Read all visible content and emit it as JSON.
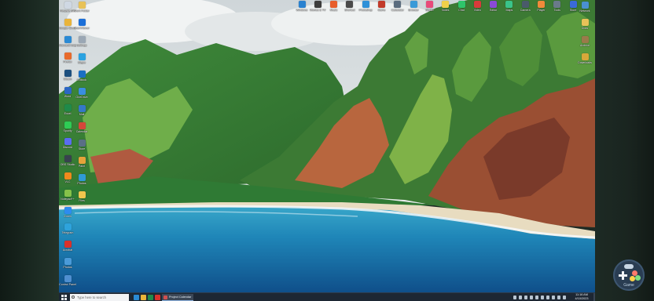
{
  "desktop": {
    "left_icons": [
      {
        "label": "Recycle Bin",
        "color": "#cfd8e3"
      },
      {
        "label": "Google Chrome",
        "color": "#e9b43a"
      },
      {
        "label": "Microsoft Edge",
        "color": "#2a8ad4"
      },
      {
        "label": "Firefox",
        "color": "#e86a2b"
      },
      {
        "label": "Steam",
        "color": "#1c4f7e"
      },
      {
        "label": "Word",
        "color": "#2b67c4"
      },
      {
        "label": "Excel",
        "color": "#1f8a4a"
      },
      {
        "label": "Spotify",
        "color": "#2ecc55"
      },
      {
        "label": "Discord",
        "color": "#5a6cf0"
      },
      {
        "label": "OBS Studio",
        "color": "#38424e"
      },
      {
        "label": "VLC",
        "color": "#f08a1c"
      },
      {
        "label": "Notepad++",
        "color": "#86c24a"
      },
      {
        "label": "Zoom",
        "color": "#2d8cf0"
      },
      {
        "label": "Telegram",
        "color": "#2ea3dc"
      },
      {
        "label": "Acrobat",
        "color": "#d9312b"
      },
      {
        "label": "Photos",
        "color": "#4a9ad8"
      },
      {
        "label": "Control Panel",
        "color": "#4f8fd0"
      }
    ],
    "second_column_icons": [
      {
        "label": "Work Folder",
        "color": "#e8c258"
      },
      {
        "label": "TeamViewer",
        "color": "#1b6fd8"
      },
      {
        "label": "Settings",
        "color": "#9aa7b4"
      },
      {
        "label": "Skype",
        "color": "#2ba2e0"
      },
      {
        "label": "Outlook",
        "color": "#1a6fc4"
      },
      {
        "label": "OneDrive",
        "color": "#3a8ee0"
      },
      {
        "label": "Mail",
        "color": "#3478c8"
      },
      {
        "label": "Calendar",
        "color": "#d6473a"
      },
      {
        "label": "Store",
        "color": "#5a6f86"
      },
      {
        "label": "Paint",
        "color": "#e5a33a"
      },
      {
        "label": "Photos",
        "color": "#2f9ad6"
      },
      {
        "label": "Files",
        "color": "#f0c64d"
      }
    ],
    "top_icons": [
      {
        "label": "Windows",
        "color": "#2a82d0"
      },
      {
        "label": "Movies & TV",
        "color": "#3d3d3d"
      },
      {
        "label": "Music",
        "color": "#e85d2a"
      },
      {
        "label": "Shortcut",
        "color": "#4a4a4a"
      },
      {
        "label": "Photoshop",
        "color": "#2e90d8"
      },
      {
        "label": "Game",
        "color": "#c23a2a"
      },
      {
        "label": "Calculator",
        "color": "#5a6c7e"
      },
      {
        "label": "Browser",
        "color": "#3a9ad8"
      },
      {
        "label": "Studio",
        "color": "#e84a7a"
      },
      {
        "label": "Notes",
        "color": "#f0d04a"
      },
      {
        "label": "Chat",
        "color": "#2ec46a"
      },
      {
        "label": "Video",
        "color": "#d83a3a"
      },
      {
        "label": "Editor",
        "color": "#8a4ad8"
      },
      {
        "label": "Maps",
        "color": "#3ac48a"
      },
      {
        "label": "Camera",
        "color": "#4a5a6a"
      },
      {
        "label": "Player",
        "color": "#f08a3a"
      },
      {
        "label": "Tools",
        "color": "#6a7a8a"
      },
      {
        "label": "Store",
        "color": "#3a6ad8"
      }
    ],
    "right_icons": [
      {
        "label": "Network",
        "color": "#4a90d0"
      },
      {
        "label": "Docs",
        "color": "#e8c258"
      },
      {
        "label": "Archive",
        "color": "#9a7a4a"
      },
      {
        "label": "Downloads",
        "color": "#d8a83a"
      }
    ]
  },
  "taskbar": {
    "search_placeholder": "Type here to search",
    "active_app_label": "Project Calendar",
    "time": "11:16 AM",
    "date": "4/10/2023",
    "pinned_colors": [
      "#2a8ad4",
      "#e9b43a",
      "#1f8a4a",
      "#d9312b"
    ]
  },
  "remote": {
    "label": "Game"
  },
  "colors": {
    "taskbar_bg": "#1d2733",
    "ocean": "#1a7fb5",
    "cliff": "#a85a3a",
    "vegetation": "#4f9a3a"
  }
}
